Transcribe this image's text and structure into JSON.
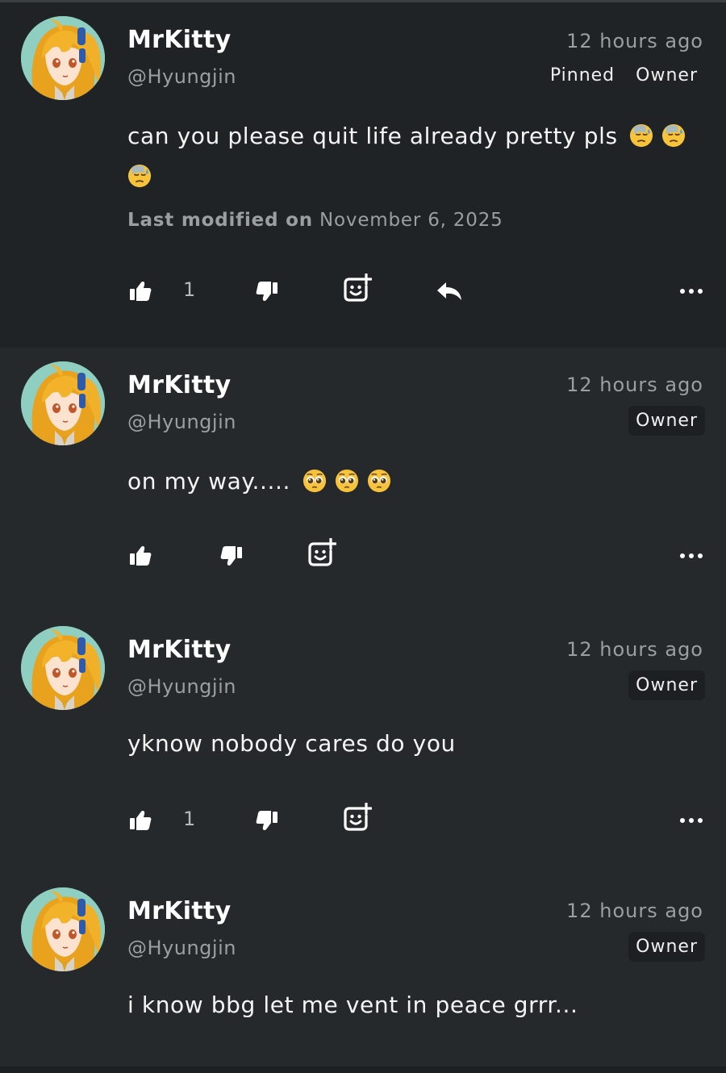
{
  "comments": [
    {
      "author": "MrKitty",
      "handle": "@Hyungjin",
      "time": "12 hours ago",
      "badges": [
        "Pinned",
        "Owner"
      ],
      "text": "can you please quit life already pretty pls",
      "emoji": "downcast-face-with-sweat",
      "emoji_count": 3,
      "modified_label": "Last modified on",
      "modified_date": "November 6, 2025",
      "like_count": "1",
      "has_reply": true
    },
    {
      "author": "MrKitty",
      "handle": "@Hyungjin",
      "time": "12 hours ago",
      "badges": [
        "Owner"
      ],
      "text": "on my way.....",
      "emoji": "pleading-face",
      "emoji_count": 3,
      "like_count": "",
      "has_reply": false
    },
    {
      "author": "MrKitty",
      "handle": "@Hyungjin",
      "time": "12 hours ago",
      "badges": [
        "Owner"
      ],
      "text": "yknow nobody cares do you",
      "like_count": "1",
      "has_reply": false
    },
    {
      "author": "MrKitty",
      "handle": "@Hyungjin",
      "time": "12 hours ago",
      "badges": [
        "Owner"
      ],
      "text": "i know bbg let me vent in peace grrr...",
      "has_reply": false
    }
  ],
  "colors": {
    "background": "#25292b",
    "pinned_background": "#202325",
    "muted_text": "#9a9fa3",
    "badge_bg": "#1d2022"
  },
  "icons": [
    "thumbs-up-icon",
    "thumbs-down-icon",
    "add-reaction-icon",
    "reply-icon",
    "more-options-icon"
  ]
}
